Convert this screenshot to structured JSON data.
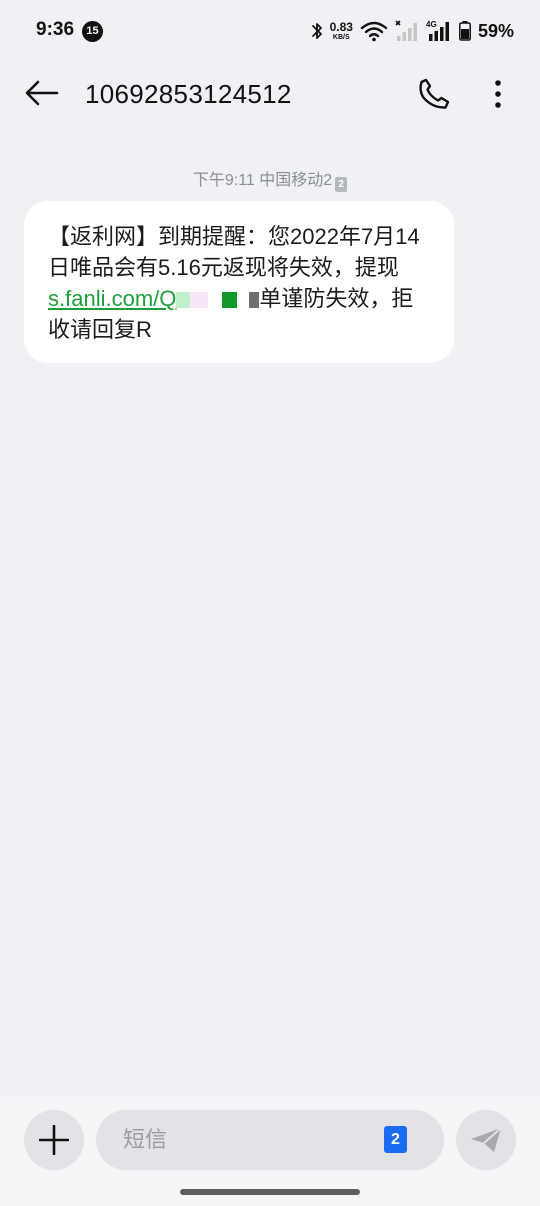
{
  "status_bar": {
    "time": "9:36",
    "notification_count": "15",
    "net_speed_value": "0.83",
    "net_speed_unit": "KB/S",
    "network_type": "4G",
    "battery_percent": "59%"
  },
  "header": {
    "title": "10692853124512"
  },
  "conversation": {
    "timestamp": "下午9:11 中国移动2",
    "sim_slot": "2",
    "message": {
      "text_before_link": "【返利网】到期提醒：您2022年7月14日唯品会有5.16元返现将失效，提现 ",
      "link_text": "s.fanli.com/Q",
      "text_after_link": "单谨防失效，拒收请回复R"
    }
  },
  "composer": {
    "placeholder": "短信",
    "sim_slot": "2"
  },
  "colors": {
    "background": "#F0F1F4",
    "bubble": "#FFFFFF",
    "link": "#1E9E3A",
    "sim_badge": "#1B6CF2"
  },
  "icons": [
    "back-arrow-icon",
    "phone-icon",
    "more-vert-icon",
    "plus-icon",
    "send-icon",
    "bluetooth-icon",
    "wifi-icon",
    "signal-icon",
    "battery-icon"
  ]
}
